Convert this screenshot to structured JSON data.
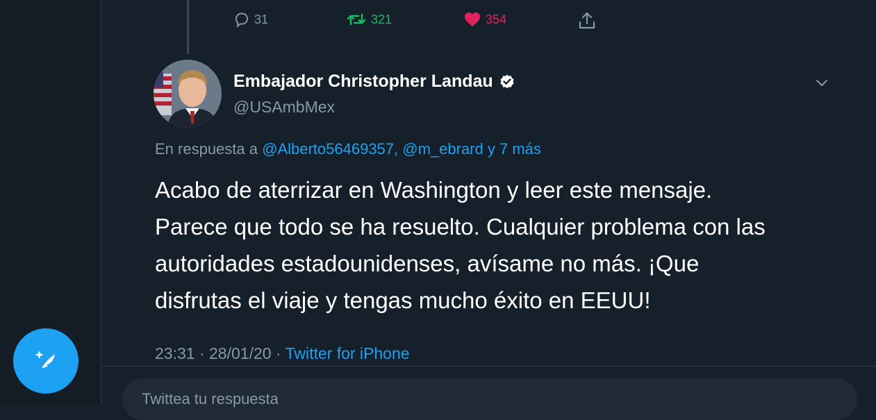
{
  "tweet": {
    "actions": {
      "reply_count": "31",
      "retweet_count": "321",
      "like_count": "354"
    },
    "author": {
      "display_name": "Embajador Christopher Landau",
      "handle": "@USAmbMex",
      "verified": true
    },
    "reply_context": {
      "prefix": "En respuesta a ",
      "mentions": "@Alberto56469357, @m_ebrard y 7 más"
    },
    "body_lines": [
      "Acabo de aterrizar en Washington y leer este mensaje.",
      "Parece que todo se ha resuelto. Cualquier problema con las",
      "autoridades estadounidenses, avísame no más. ¡Que",
      "disfrutas el viaje y tengas mucho éxito en EEUU!"
    ],
    "meta": {
      "time": "23:31",
      "separator": " · ",
      "date": "28/01/20",
      "source": "Twitter for iPhone"
    }
  },
  "reply_box": {
    "placeholder": "Twittea tu respuesta"
  },
  "colors": {
    "background": "#15202b",
    "accent": "#1da1f2",
    "retweet": "#17bf63",
    "like": "#e0245e",
    "muted": "#8899a6"
  },
  "icons": [
    "reply-icon",
    "retweet-icon",
    "heart-icon",
    "share-icon",
    "verified-badge-icon",
    "chevron-down-icon",
    "compose-tweet-icon"
  ]
}
